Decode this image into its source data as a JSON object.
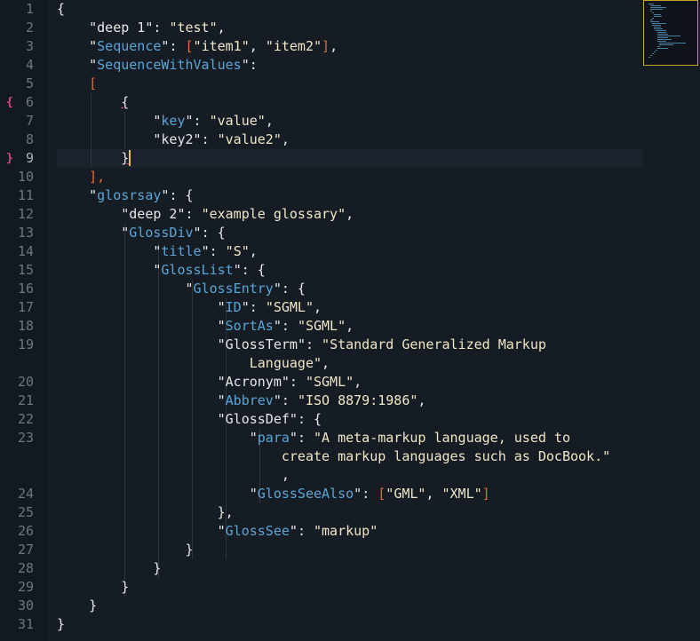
{
  "editor": {
    "line_numbers": [
      "1",
      "2",
      "3",
      "4",
      "5",
      "6",
      "7",
      "8",
      "9",
      "10",
      "11",
      "12",
      "13",
      "14",
      "15",
      "16",
      "17",
      "18",
      "19",
      "",
      "20",
      "21",
      "22",
      "23",
      "",
      "",
      "24",
      "25",
      "26",
      "27",
      "28",
      "29",
      "30",
      "31"
    ],
    "fold_open_marker": "{",
    "fold_close_marker": "}",
    "lines": {
      "l1": "{",
      "l2_k": "deep 1",
      "l2_v": "test",
      "l3_k": "Sequence",
      "l3_v1": "item1",
      "l3_v2": "item2",
      "l4_k": "SequenceWithValues",
      "l5": "[",
      "l6": "{",
      "l7_k": "key",
      "l7_v": "value",
      "l8_k": "key2",
      "l8_v": "value2",
      "l9": "}",
      "l10": "],",
      "l11_k": "glosrsay",
      "l12_k": "deep 2",
      "l12_v": "example glossary",
      "l13_k": "GlossDiv",
      "l14_k": "title",
      "l14_v": "S",
      "l15_k": "GlossList",
      "l16_k": "GlossEntry",
      "l17_k": "ID",
      "l17_v": "SGML",
      "l18_k": "SortAs",
      "l18_v": "SGML",
      "l19_k": "GlossTerm",
      "l19_v": "Standard Generalized Markup",
      "l19b_v": "Language",
      "l20_k": "Acronym",
      "l20_v": "SGML",
      "l21_k": "Abbrev",
      "l21_v": "ISO 8879:1986",
      "l22_k": "GlossDef",
      "l23_k": "para",
      "l23_v": "A meta-markup language, used to",
      "l23b_v": "create markup languages such as DocBook.",
      "l23c": ",",
      "l24_k": "GlossSeeAlso",
      "l24_v1": "GML",
      "l24_v2": "XML",
      "l25": "},",
      "l26_k": "GlossSee",
      "l26_v": "markup",
      "l27": "}",
      "l28": "}",
      "l29": "}",
      "l30": "}",
      "l31": "}"
    }
  },
  "colors": {
    "background": "#161c24",
    "key": "#5aa6d6",
    "string": "#f0e6c8",
    "bracket": "#e06c3c",
    "fold_marker": "#d54b7a",
    "minimap_border": "#c9a227"
  }
}
